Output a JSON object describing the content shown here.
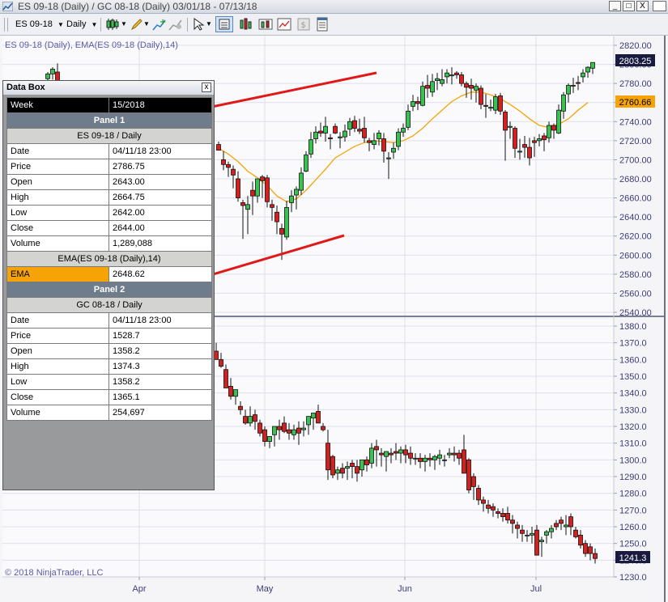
{
  "window": {
    "title": "ES 09-18 (Daily) / GC 08-18 (Daily)  03/01/18 - 07/13/18",
    "buttons": {
      "minimize": "_",
      "maximize": "□",
      "close": "X"
    }
  },
  "toolbar": {
    "instrument": "ES 09-18",
    "interval": "Daily",
    "icons": [
      "candlestick-icon",
      "pencil-icon",
      "add-indicator-icon",
      "strategy-icon",
      "cursor-icon",
      "databox-icon",
      "bar-type-icon",
      "chart-style-icon",
      "price-icon",
      "properties-icon"
    ]
  },
  "chart_data": [
    {
      "type": "candlestick",
      "label": "ES 09-18 (Daily), EMA(ES 09-18 (Daily),14)",
      "ylim": [
        2540,
        2820
      ],
      "ytick_labels": [
        "2820.00",
        "2800.00",
        "2780.00",
        "2760.00",
        "2740.00",
        "2720.00",
        "2700.00",
        "2680.00",
        "2660.00",
        "2640.00",
        "2620.00",
        "2600.00",
        "2580.00",
        "2560.00",
        "2540.00"
      ],
      "price_markers": [
        {
          "value": "2803.25",
          "color": "#1a1a40"
        },
        {
          "value": "2760.66",
          "color": "#f5a306"
        }
      ],
      "series": [
        {
          "name": "ES 09-18",
          "x": [
            59,
            65,
            71,
            270,
            276,
            282,
            288,
            294,
            300,
            306,
            312,
            318,
            324,
            330,
            336,
            342,
            348,
            354,
            360,
            366,
            372,
            378,
            384,
            390,
            396,
            402,
            408,
            414,
            420,
            426,
            432,
            438,
            444,
            450,
            456,
            462,
            468,
            474,
            480,
            486,
            492,
            498,
            504,
            510,
            516,
            522,
            528,
            534,
            540,
            546,
            552,
            558,
            564,
            570,
            576,
            582,
            588,
            594,
            600,
            606,
            612,
            618,
            624,
            630,
            636,
            642,
            648,
            654,
            660,
            666,
            672,
            678,
            684,
            690,
            696,
            702,
            708,
            714,
            720,
            726,
            732
          ],
          "open": [
            2785,
            2790,
            2792,
            2716,
            2700,
            2695,
            2690,
            2680,
            2655,
            2648,
            2668,
            2662,
            2682,
            2681,
            2653,
            2645,
            2628,
            2619,
            2655,
            2663,
            2668,
            2688,
            2706,
            2722,
            2730,
            2728,
            2723,
            2735,
            2723,
            2724,
            2732,
            2741,
            2732,
            2733,
            2720,
            2716,
            2722,
            2722,
            2701,
            2708,
            2714,
            2729,
            2734,
            2756,
            2761,
            2757,
            2778,
            2771,
            2783,
            2780,
            2787,
            2788,
            2791,
            2789,
            2780,
            2778,
            2773,
            2775,
            2757,
            2754,
            2752,
            2767,
            2750,
            2734,
            2733,
            2708,
            2716,
            2713,
            2720,
            2720,
            2725,
            2723,
            2736,
            2728,
            2751,
            2769,
            2778,
            2781,
            2787,
            2792,
            2796
          ],
          "high": [
            2792,
            2797,
            2801,
            2719,
            2709,
            2698,
            2694,
            2688,
            2658,
            2662,
            2677,
            2670,
            2684,
            2684,
            2658,
            2652,
            2633,
            2657,
            2668,
            2672,
            2692,
            2709,
            2729,
            2735,
            2739,
            2745,
            2727,
            2738,
            2729,
            2737,
            2744,
            2746,
            2743,
            2745,
            2723,
            2728,
            2731,
            2728,
            2708,
            2718,
            2733,
            2738,
            2758,
            2768,
            2766,
            2782,
            2789,
            2790,
            2791,
            2795,
            2795,
            2797,
            2793,
            2792,
            2782,
            2785,
            2780,
            2778,
            2769,
            2763,
            2769,
            2770,
            2752,
            2740,
            2735,
            2722,
            2725,
            2723,
            2724,
            2727,
            2728,
            2740,
            2738,
            2758,
            2771,
            2780,
            2786,
            2788,
            2795,
            2798,
            2799
          ],
          "low": [
            2782,
            2784,
            2788,
            2711,
            2689,
            2682,
            2670,
            2656,
            2617,
            2622,
            2642,
            2655,
            2660,
            2650,
            2636,
            2622,
            2595,
            2616,
            2645,
            2648,
            2663,
            2687,
            2702,
            2717,
            2724,
            2719,
            2711,
            2727,
            2712,
            2719,
            2725,
            2729,
            2727,
            2718,
            2709,
            2711,
            2715,
            2697,
            2680,
            2701,
            2710,
            2724,
            2731,
            2751,
            2752,
            2756,
            2765,
            2766,
            2773,
            2777,
            2780,
            2779,
            2785,
            2777,
            2765,
            2763,
            2760,
            2753,
            2744,
            2751,
            2748,
            2747,
            2699,
            2722,
            2702,
            2700,
            2702,
            2694,
            2703,
            2714,
            2709,
            2718,
            2722,
            2727,
            2743,
            2760,
            2770,
            2773,
            2781,
            2786,
            2790
          ],
          "close": [
            2790,
            2795,
            2783,
            2710,
            2695,
            2692,
            2684,
            2660,
            2652,
            2653,
            2662,
            2680,
            2678,
            2656,
            2650,
            2635,
            2622,
            2650,
            2662,
            2669,
            2686,
            2705,
            2721,
            2729,
            2728,
            2735,
            2722,
            2728,
            2724,
            2730,
            2740,
            2733,
            2730,
            2723,
            2718,
            2720,
            2728,
            2709,
            2702,
            2712,
            2729,
            2733,
            2751,
            2761,
            2759,
            2777,
            2775,
            2782,
            2785,
            2784,
            2791,
            2789,
            2789,
            2780,
            2776,
            2775,
            2777,
            2758,
            2756,
            2755,
            2766,
            2751,
            2731,
            2735,
            2712,
            2709,
            2713,
            2702,
            2718,
            2722,
            2721,
            2736,
            2731,
            2752,
            2768,
            2778,
            2778,
            2780,
            2791,
            2797,
            2802
          ],
          "color_up": "#39c24f",
          "color_down": "#d61f1f"
        },
        {
          "name": "EMA(ES 09-18 (Daily),14)",
          "color": "#f5a306",
          "x": [
            270,
            282,
            294,
            306,
            318,
            330,
            342,
            354,
            366,
            378,
            390,
            402,
            414,
            426,
            438,
            450,
            462,
            474,
            486,
            498,
            510,
            522,
            534,
            546,
            558,
            570,
            582,
            594,
            606,
            618,
            630,
            642,
            654,
            666,
            678,
            690,
            702,
            714,
            726
          ],
          "values": [
            2712,
            2706,
            2698,
            2688,
            2681,
            2673,
            2662,
            2656,
            2659,
            2668,
            2679,
            2690,
            2702,
            2708,
            2714,
            2718,
            2720,
            2719,
            2718,
            2720,
            2725,
            2733,
            2743,
            2752,
            2761,
            2767,
            2771,
            2771,
            2768,
            2764,
            2758,
            2751,
            2743,
            2736,
            2734,
            2737,
            2743,
            2752,
            2760
          ]
        }
      ]
    },
    {
      "type": "candlestick",
      "ylim": [
        1230,
        1385
      ],
      "ytick_labels": [
        "1380.0",
        "1370.0",
        "1360.0",
        "1350.0",
        "1340.0",
        "1330.0",
        "1320.0",
        "1310.0",
        "1300.0",
        "1290.0",
        "1280.0",
        "1270.0",
        "1260.0",
        "1250.0",
        "1240.0",
        "1230.0"
      ],
      "price_markers": [
        {
          "value": "1241.3",
          "color": "#1a1a40"
        }
      ],
      "series": [
        {
          "name": "GC 08-18",
          "x": [
            267,
            273,
            279,
            285,
            291,
            297,
            303,
            309,
            315,
            321,
            327,
            333,
            339,
            345,
            351,
            357,
            363,
            369,
            375,
            381,
            387,
            393,
            399,
            405,
            411,
            417,
            423,
            429,
            435,
            441,
            447,
            453,
            459,
            465,
            471,
            477,
            483,
            489,
            495,
            501,
            507,
            513,
            519,
            525,
            531,
            537,
            543,
            549,
            555,
            561,
            567,
            573,
            579,
            585,
            591,
            597,
            603,
            609,
            615,
            621,
            627,
            633,
            639,
            645,
            651,
            657,
            663,
            669,
            675,
            681,
            687,
            693,
            699,
            705,
            711,
            717,
            723,
            729,
            735
          ],
          "open": [
            1365,
            1360,
            1354,
            1344,
            1338,
            1332,
            1326,
            1322,
            1327,
            1322,
            1318,
            1311,
            1315,
            1320,
            1322,
            1318,
            1315,
            1319,
            1318,
            1321,
            1325,
            1329,
            1320,
            1310,
            1302,
            1292,
            1295,
            1295,
            1298,
            1296,
            1294,
            1300,
            1298,
            1308,
            1304,
            1302,
            1304,
            1305,
            1304,
            1306,
            1304,
            1301,
            1301,
            1299,
            1301,
            1300,
            1301,
            1300,
            1303,
            1304,
            1304,
            1306,
            1300,
            1290,
            1283,
            1276,
            1273,
            1272,
            1269,
            1268,
            1268,
            1264,
            1261,
            1258,
            1255,
            1255,
            1258,
            1251,
            1255,
            1257,
            1262,
            1264,
            1260,
            1266,
            1258,
            1255,
            1250,
            1248,
            1244
          ],
          "high": [
            1370,
            1364,
            1357,
            1349,
            1340,
            1335,
            1330,
            1332,
            1330,
            1324,
            1320,
            1314,
            1318,
            1324,
            1326,
            1322,
            1321,
            1323,
            1323,
            1325,
            1328,
            1333,
            1322,
            1318,
            1303,
            1296,
            1298,
            1299,
            1300,
            1300,
            1299,
            1302,
            1310,
            1312,
            1307,
            1305,
            1307,
            1310,
            1308,
            1309,
            1308,
            1304,
            1304,
            1303,
            1304,
            1303,
            1306,
            1303,
            1307,
            1308,
            1306,
            1315,
            1301,
            1292,
            1285,
            1278,
            1276,
            1274,
            1271,
            1271,
            1272,
            1267,
            1263,
            1261,
            1258,
            1260,
            1261,
            1254,
            1258,
            1261,
            1264,
            1266,
            1267,
            1268,
            1260,
            1258,
            1252,
            1250,
            1247
          ],
          "low": [
            1361,
            1355,
            1348,
            1336,
            1333,
            1327,
            1321,
            1320,
            1318,
            1314,
            1308,
            1307,
            1308,
            1312,
            1316,
            1312,
            1312,
            1309,
            1314,
            1315,
            1318,
            1326,
            1317,
            1288,
            1289,
            1288,
            1289,
            1288,
            1289,
            1287,
            1290,
            1293,
            1295,
            1296,
            1296,
            1293,
            1298,
            1300,
            1298,
            1298,
            1297,
            1297,
            1295,
            1293,
            1296,
            1294,
            1297,
            1296,
            1301,
            1299,
            1297,
            1293,
            1280,
            1276,
            1273,
            1269,
            1268,
            1266,
            1265,
            1263,
            1262,
            1256,
            1253,
            1251,
            1251,
            1250,
            1246,
            1242,
            1250,
            1253,
            1258,
            1258,
            1255,
            1255,
            1253,
            1247,
            1242,
            1240,
            1238
          ],
          "close": [
            1360,
            1356,
            1343,
            1338,
            1342,
            1330,
            1322,
            1326,
            1323,
            1316,
            1311,
            1314,
            1320,
            1318,
            1317,
            1316,
            1318,
            1316,
            1319,
            1326,
            1328,
            1322,
            1318,
            1294,
            1291,
            1294,
            1292,
            1296,
            1296,
            1292,
            1300,
            1297,
            1307,
            1306,
            1303,
            1305,
            1303,
            1304,
            1306,
            1303,
            1301,
            1301,
            1299,
            1301,
            1300,
            1302,
            1303,
            1300,
            1304,
            1303,
            1301,
            1292,
            1282,
            1284,
            1276,
            1274,
            1271,
            1270,
            1268,
            1266,
            1264,
            1262,
            1259,
            1256,
            1255,
            1256,
            1243,
            1252,
            1257,
            1259,
            1260,
            1262,
            1261,
            1260,
            1254,
            1249,
            1244,
            1244,
            1241
          ],
          "color_up": "#39c24f",
          "color_down": "#d61f1f"
        }
      ]
    }
  ],
  "x_axis": {
    "tick_labels": [
      "Apr",
      "May",
      "Jun",
      "Jul"
    ],
    "x": [
      172,
      327,
      500,
      662
    ]
  },
  "copyright": "© 2018 NinjaTrader, LLC",
  "databox": {
    "title": "Data Box",
    "close": "x",
    "week_key": "Week",
    "week_value": "15/2018",
    "panel1": "Panel 1",
    "inst1": "ES 09-18 / Daily",
    "rows1": [
      {
        "key": "Date",
        "value": "04/11/18 23:00"
      },
      {
        "key": "Price",
        "value": "2786.75"
      },
      {
        "key": "Open",
        "value": "2643.00"
      },
      {
        "key": "High",
        "value": "2664.75"
      },
      {
        "key": "Low",
        "value": "2642.00"
      },
      {
        "key": "Close",
        "value": "2644.00"
      },
      {
        "key": "Volume",
        "value": "1,289,088"
      }
    ],
    "indicator": "EMA(ES 09-18 (Daily),14)",
    "ema_key": "EMA",
    "ema_value": "2648.62",
    "panel2": "Panel 2",
    "inst2": "GC 08-18 / Daily",
    "rows2": [
      {
        "key": "Date",
        "value": "04/11/18 23:00"
      },
      {
        "key": "Price",
        "value": "1528.7"
      },
      {
        "key": "Open",
        "value": "1358.2"
      },
      {
        "key": "High",
        "value": "1374.3"
      },
      {
        "key": "Low",
        "value": "1358.2"
      },
      {
        "key": "Close",
        "value": "1365.1"
      },
      {
        "key": "Volume",
        "value": "254,697"
      }
    ]
  },
  "annotations": {
    "arrow_color": "#e01818"
  },
  "colors": {
    "plot_bg": "#f5f5f7",
    "grid": "#dde0ea",
    "axis_text": "#3c3c78",
    "label_blue": "#5a5aa8"
  }
}
